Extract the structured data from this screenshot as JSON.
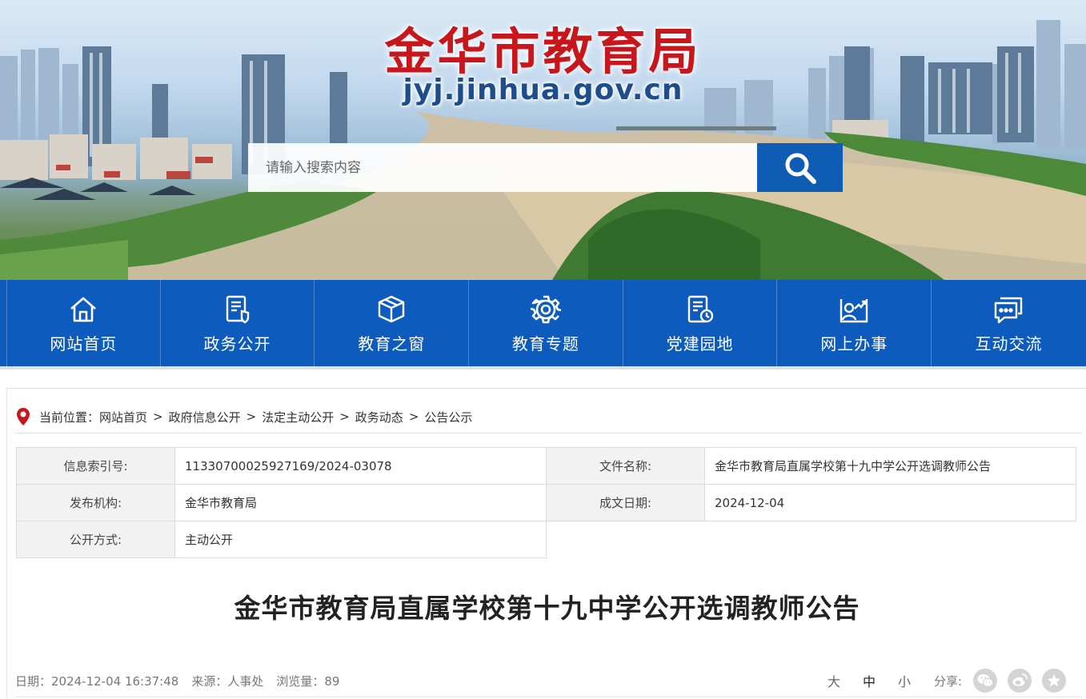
{
  "site": {
    "title": "金华市教育局",
    "domain": "jyj.jinhua.gov.cn"
  },
  "search": {
    "placeholder": "请输入搜索内容",
    "button_icon": "search-icon"
  },
  "nav": {
    "items": [
      {
        "label": "网站首页",
        "icon": "home-icon"
      },
      {
        "label": "政务公开",
        "icon": "document-shield-icon"
      },
      {
        "label": "教育之窗",
        "icon": "box-icon"
      },
      {
        "label": "教育专题",
        "icon": "gear-icon"
      },
      {
        "label": "党建园地",
        "icon": "document-clock-icon"
      },
      {
        "label": "网上办事",
        "icon": "user-chart-icon"
      },
      {
        "label": "互动交流",
        "icon": "chat-icon"
      }
    ]
  },
  "breadcrumb": {
    "prefix": "当前位置：",
    "items": [
      "网站首页",
      "政府信息公开",
      "法定主动公开",
      "政务动态",
      "公告公示"
    ],
    "separator": ">"
  },
  "meta": {
    "index_no_label": "信息索引号:",
    "index_no": "11330700025927169/2024-03078",
    "file_name_label": "文件名称:",
    "file_name": "金华市教育局直属学校第十九中学公开选调教师公告",
    "publisher_label": "发布机构:",
    "publisher": "金华市教育局",
    "date_label": "成文日期:",
    "date": "2024-12-04",
    "open_mode_label": "公开方式:",
    "open_mode": "主动公开"
  },
  "article": {
    "title": "金华市教育局直属学校第十九中学公开选调教师公告",
    "date_text": "日期：2024-12-04 16:37:48",
    "source_text": "来源：人事处",
    "views_text": "浏览量：89"
  },
  "font_size": {
    "options": [
      "大",
      "中",
      "小"
    ],
    "selected": "中"
  },
  "share": {
    "label": "分享:",
    "targets": [
      "wechat-icon",
      "weibo-icon",
      "favorite-icon"
    ]
  },
  "colors": {
    "brand_red": "#c8161d",
    "nav_blue": "#0d5bbd",
    "search_blue": "#0f5cb5"
  }
}
